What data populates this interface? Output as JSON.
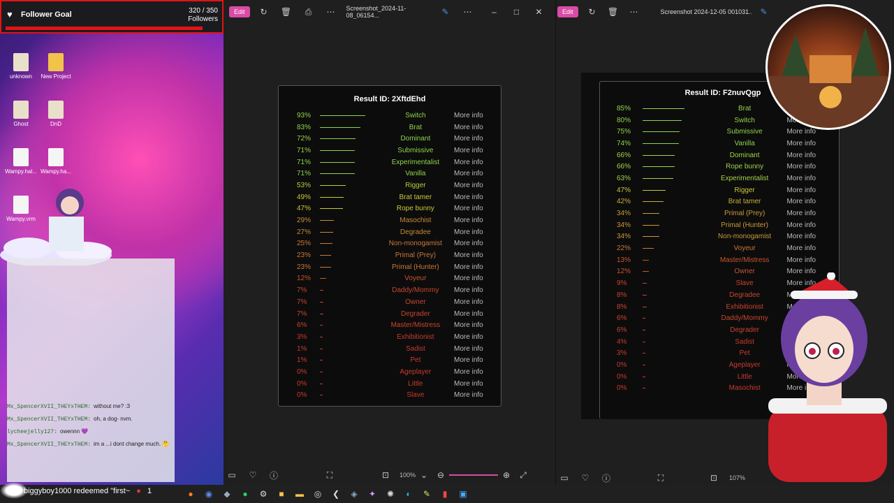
{
  "follower_goal": {
    "title": "Follower Goal",
    "count": "320 / 350",
    "label": "Followers"
  },
  "desktop_icons": [
    {
      "label": "unknown",
      "type": "game"
    },
    {
      "label": "New Project",
      "type": "folder"
    },
    {
      "label": "Ghost",
      "type": "game"
    },
    {
      "label": "DnD",
      "type": "game"
    },
    {
      "label": "Wampy.hal...",
      "type": "file"
    },
    {
      "label": "Wampy.ha...",
      "type": "file"
    },
    {
      "label": "Wampy.vrm",
      "type": "file"
    }
  ],
  "chat": [
    {
      "user": "Mx_SpencerXVII_THEYxTHEM:",
      "text": "without me? :3"
    },
    {
      "user": "Mx_SpencerXVII_THEYxTHEM:",
      "text": "oh, a dog- nvm."
    },
    {
      "user": "lycheejelly127:",
      "text": "owennn 💜"
    },
    {
      "user": "Mx_SpencerXVII_THEYxTHEM:",
      "text": "im a ...i dont change much. 🤔"
    }
  ],
  "redeem_text": "biggyboy1000 redeemed \"first~",
  "redeem_count": "1",
  "window1": {
    "edit_label": "Edit",
    "filename": "Screenshot_2024-11-08_06154...",
    "zoom": "100%",
    "result_title": "Result ID: 2XftdEhd",
    "more_info": "More info",
    "rows": [
      {
        "pct": "93%",
        "name": "Switch",
        "v": 0.93,
        "color": "#8fd44a"
      },
      {
        "pct": "83%",
        "name": "Brat",
        "v": 0.83,
        "color": "#8fd44a"
      },
      {
        "pct": "72%",
        "name": "Dominant",
        "v": 0.72,
        "color": "#8fd44a"
      },
      {
        "pct": "71%",
        "name": "Submissive",
        "v": 0.71,
        "color": "#8fd44a"
      },
      {
        "pct": "71%",
        "name": "Experimentalist",
        "v": 0.71,
        "color": "#8fd44a"
      },
      {
        "pct": "71%",
        "name": "Vanilla",
        "v": 0.71,
        "color": "#8fd44a"
      },
      {
        "pct": "53%",
        "name": "Rigger",
        "v": 0.53,
        "color": "#b5cf3a"
      },
      {
        "pct": "49%",
        "name": "Brat tamer",
        "v": 0.49,
        "color": "#c9c93a"
      },
      {
        "pct": "47%",
        "name": "Rope bunny",
        "v": 0.47,
        "color": "#c9c93a"
      },
      {
        "pct": "29%",
        "name": "Masochist",
        "v": 0.29,
        "color": "#c98a3a"
      },
      {
        "pct": "27%",
        "name": "Degradee",
        "v": 0.27,
        "color": "#c98a3a"
      },
      {
        "pct": "25%",
        "name": "Non-monogamist",
        "v": 0.25,
        "color": "#c9783a"
      },
      {
        "pct": "23%",
        "name": "Primal (Prey)",
        "v": 0.23,
        "color": "#c9783a"
      },
      {
        "pct": "23%",
        "name": "Primal (Hunter)",
        "v": 0.23,
        "color": "#c9783a"
      },
      {
        "pct": "12%",
        "name": "Voyeur",
        "v": 0.12,
        "color": "#c8552e"
      },
      {
        "pct": "7%",
        "name": "Daddy/Mommy",
        "v": 0.07,
        "color": "#c8452e"
      },
      {
        "pct": "7%",
        "name": "Owner",
        "v": 0.07,
        "color": "#c8452e"
      },
      {
        "pct": "7%",
        "name": "Degrader",
        "v": 0.07,
        "color": "#c8452e"
      },
      {
        "pct": "6%",
        "name": "Master/Mistress",
        "v": 0.06,
        "color": "#c8452e"
      },
      {
        "pct": "3%",
        "name": "Exhibitionist",
        "v": 0.03,
        "color": "#c83a2e"
      },
      {
        "pct": "1%",
        "name": "Sadist",
        "v": 0.01,
        "color": "#c83a2e"
      },
      {
        "pct": "1%",
        "name": "Pet",
        "v": 0.01,
        "color": "#c83a2e"
      },
      {
        "pct": "0%",
        "name": "Ageplayer",
        "v": 0.0,
        "color": "#c83a2e"
      },
      {
        "pct": "0%",
        "name": "Little",
        "v": 0.0,
        "color": "#c83a2e"
      },
      {
        "pct": "0%",
        "name": "Slave",
        "v": 0.0,
        "color": "#c83a2e"
      }
    ]
  },
  "window2": {
    "edit_label": "Edit",
    "filename": "Screenshot 2024-12-05 001031...",
    "zoom": "107%",
    "result_title": "Result ID: F2nuvQgp",
    "more_info": "More info",
    "rows": [
      {
        "pct": "85%",
        "name": "Brat",
        "v": 0.85,
        "color": "#8fd44a"
      },
      {
        "pct": "80%",
        "name": "Switch",
        "v": 0.8,
        "color": "#8fd44a"
      },
      {
        "pct": "75%",
        "name": "Submissive",
        "v": 0.75,
        "color": "#8fd44a"
      },
      {
        "pct": "74%",
        "name": "Vanilla",
        "v": 0.74,
        "color": "#8fd44a"
      },
      {
        "pct": "66%",
        "name": "Dominant",
        "v": 0.66,
        "color": "#9fd44a"
      },
      {
        "pct": "66%",
        "name": "Rope bunny",
        "v": 0.66,
        "color": "#9fd44a"
      },
      {
        "pct": "63%",
        "name": "Experimentalist",
        "v": 0.63,
        "color": "#a5d04a"
      },
      {
        "pct": "47%",
        "name": "Rigger",
        "v": 0.47,
        "color": "#c9c93a"
      },
      {
        "pct": "42%",
        "name": "Brat tamer",
        "v": 0.42,
        "color": "#c9b03a"
      },
      {
        "pct": "34%",
        "name": "Primal (Prey)",
        "v": 0.34,
        "color": "#c99a3a"
      },
      {
        "pct": "34%",
        "name": "Primal (Hunter)",
        "v": 0.34,
        "color": "#c99a3a"
      },
      {
        "pct": "34%",
        "name": "Non-monogamist",
        "v": 0.34,
        "color": "#c99a3a"
      },
      {
        "pct": "22%",
        "name": "Voyeur",
        "v": 0.22,
        "color": "#c9783a"
      },
      {
        "pct": "13%",
        "name": "Master/Mistress",
        "v": 0.13,
        "color": "#c8552e"
      },
      {
        "pct": "12%",
        "name": "Owner",
        "v": 0.12,
        "color": "#c8552e"
      },
      {
        "pct": "9%",
        "name": "Slave",
        "v": 0.09,
        "color": "#c8452e"
      },
      {
        "pct": "8%",
        "name": "Degradee",
        "v": 0.08,
        "color": "#c8452e"
      },
      {
        "pct": "8%",
        "name": "Exhibitionist",
        "v": 0.08,
        "color": "#c8452e"
      },
      {
        "pct": "6%",
        "name": "Daddy/Mommy",
        "v": 0.06,
        "color": "#c8452e"
      },
      {
        "pct": "6%",
        "name": "Degrader",
        "v": 0.06,
        "color": "#c8452e"
      },
      {
        "pct": "4%",
        "name": "Sadist",
        "v": 0.04,
        "color": "#c83a2e"
      },
      {
        "pct": "3%",
        "name": "Pet",
        "v": 0.03,
        "color": "#c83a2e"
      },
      {
        "pct": "0%",
        "name": "Ageplayer",
        "v": 0.0,
        "color": "#c83a2e"
      },
      {
        "pct": "0%",
        "name": "Little",
        "v": 0.0,
        "color": "#c83a2e"
      },
      {
        "pct": "0%",
        "name": "Masochist",
        "v": 0.0,
        "color": "#c83a2e"
      }
    ]
  }
}
